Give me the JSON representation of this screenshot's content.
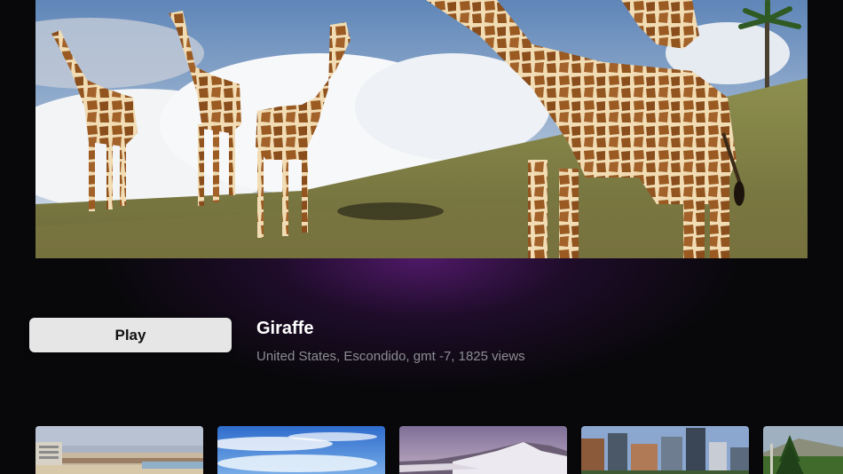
{
  "hero": {
    "image": "giraffes-on-hillside-photo"
  },
  "player": {
    "play_label": "Play",
    "title": "Giraffe",
    "subtitle": "United States, Escondido, gmt -7, 1825 views"
  },
  "thumbnails": [
    {
      "image": "beach-city-photo"
    },
    {
      "image": "blue-sky-clouds-photo"
    },
    {
      "image": "snowy-mountain-photo"
    },
    {
      "image": "city-skyscrapers-photo"
    },
    {
      "image": "green-forest-hills-photo"
    }
  ],
  "colors": {
    "background": "#08080a",
    "accent_glow": "#5c1c78",
    "button_bg": "#e6e6e6"
  }
}
